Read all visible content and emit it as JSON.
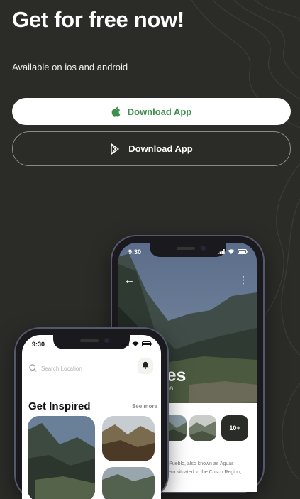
{
  "hero": {
    "title": "Get for free now!",
    "subtitle": "Available on ios and android"
  },
  "buttons": {
    "ios": {
      "label": "Download App",
      "icon": "apple-icon",
      "color": "#3e8f4e"
    },
    "android": {
      "label": "Download App",
      "icon": "google-play-icon"
    }
  },
  "colors": {
    "background": "#2b2c28",
    "accent_green": "#3e8f4e"
  },
  "phone_back": {
    "time": "9:30",
    "title_lines": [
      "s",
      "ntes"
    ],
    "subtitle": "mba",
    "more_badge": "10+",
    "description": "chu Pueblo, also known as Aguas\nin Peru situated in the Cusco Region,"
  },
  "phone_front": {
    "time": "9:30",
    "search_placeholder": "Search Location",
    "section_title": "Get Inspired",
    "see_more": "See more"
  }
}
